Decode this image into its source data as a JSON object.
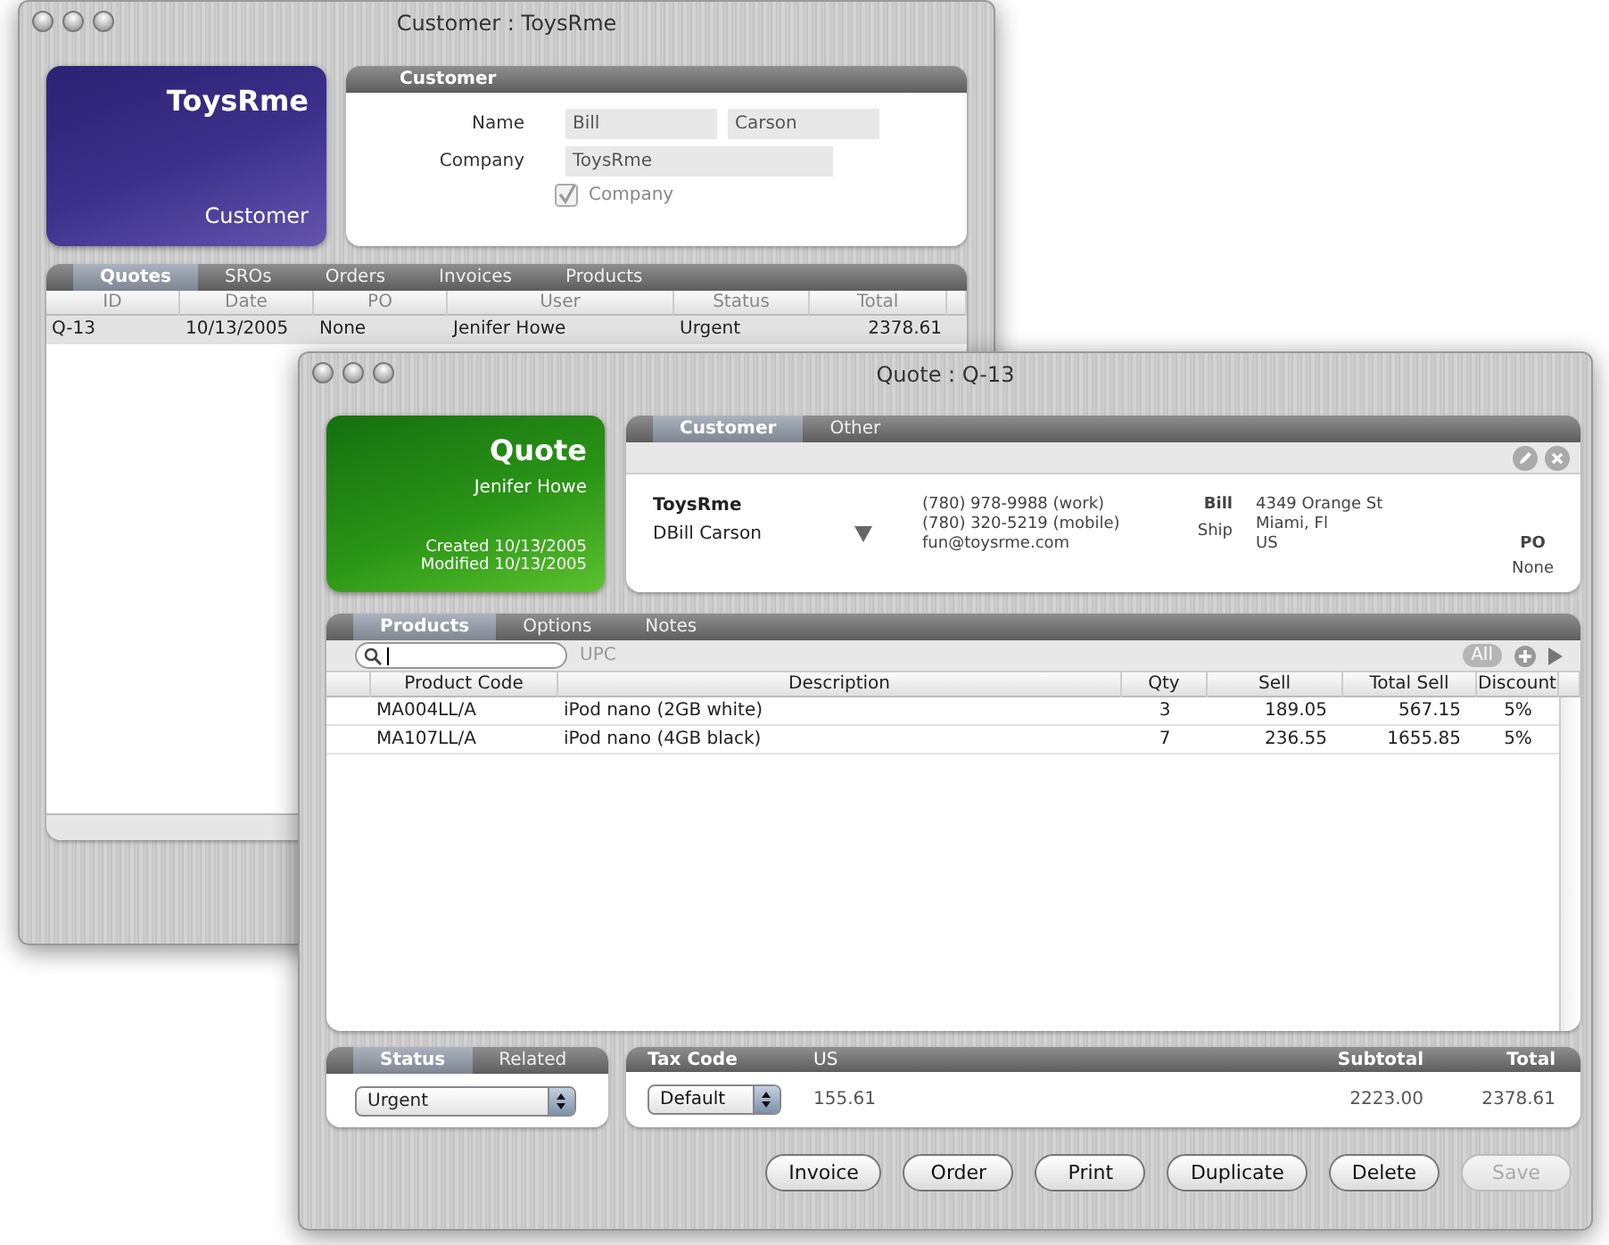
{
  "customer_window": {
    "title": "Customer : ToysRme",
    "card": {
      "name": "ToysRme",
      "type_label": "Customer"
    },
    "customer_panel": {
      "heading": "Customer",
      "name_label": "Name",
      "first_name": "Bill",
      "last_name": "Carson",
      "company_label": "Company",
      "company": "ToysRme",
      "company_checkbox": {
        "label": "Company",
        "checked": true,
        "disabled": true
      }
    },
    "tabs": [
      {
        "label": "Quotes",
        "selected": true
      },
      {
        "label": "SROs",
        "selected": false
      },
      {
        "label": "Orders",
        "selected": false
      },
      {
        "label": "Invoices",
        "selected": false
      },
      {
        "label": "Products",
        "selected": false
      }
    ],
    "table": {
      "columns": [
        "ID",
        "Date",
        "PO",
        "User",
        "Status",
        "Total"
      ],
      "rows": [
        {
          "cells": [
            "Q-13",
            "10/13/2005",
            "None",
            "Jenifer Howe",
            "Urgent",
            "2378.61"
          ],
          "selected": true
        }
      ]
    }
  },
  "quote_window": {
    "title": "Quote : Q-13",
    "card": {
      "title": "Quote",
      "user": "Jenifer Howe",
      "created": "Created 10/13/2005",
      "modified": "Modified 10/13/2005"
    },
    "customer_tabs": [
      {
        "label": "Customer",
        "selected": true
      },
      {
        "label": "Other",
        "selected": false
      }
    ],
    "customer_info": {
      "company": "ToysRme",
      "contact": "DBill Carson",
      "contact_lines": [
        "(780) 978-9988 (work)",
        "(780) 320-5219 (mobile)",
        "fun@toysrme.com"
      ],
      "bill_label": "Bill",
      "ship_label": "Ship",
      "address_lines": [
        "4349 Orange St",
        "Miami, Fl",
        "US"
      ],
      "po_label": "PO",
      "po": "None"
    },
    "product_tabs": [
      {
        "label": "Products",
        "selected": true
      },
      {
        "label": "Options",
        "selected": false
      },
      {
        "label": "Notes",
        "selected": false
      }
    ],
    "upc_label": "UPC",
    "filter_button": "All",
    "table": {
      "columns": [
        "Product Code",
        "Description",
        "Qty",
        "Sell",
        "Total Sell",
        "Discount"
      ],
      "rows": [
        [
          "MA004LL/A",
          "iPod nano (2GB white)",
          "3",
          "189.05",
          "567.15",
          "5%"
        ],
        [
          "MA107LL/A",
          "iPod nano (4GB black)",
          "7",
          "236.55",
          "1655.85",
          "5%"
        ]
      ]
    },
    "status_tabs": [
      {
        "label": "Status",
        "selected": true
      },
      {
        "label": "Related",
        "selected": false
      }
    ],
    "status_select": "Urgent",
    "tax": {
      "tax_code_heading": "Tax Code",
      "tax_region": "US",
      "subtotal_heading": "Subtotal",
      "total_heading": "Total",
      "tax_code": "Default",
      "tax_amount": "155.61",
      "subtotal": "2223.00",
      "total": "2378.61"
    },
    "buttons": [
      {
        "label": "Invoice",
        "disabled": false
      },
      {
        "label": "Order",
        "disabled": false
      },
      {
        "label": "Print",
        "disabled": false
      },
      {
        "label": "Duplicate",
        "disabled": false
      },
      {
        "label": "Delete",
        "disabled": false
      },
      {
        "label": "Save",
        "disabled": true
      }
    ]
  }
}
